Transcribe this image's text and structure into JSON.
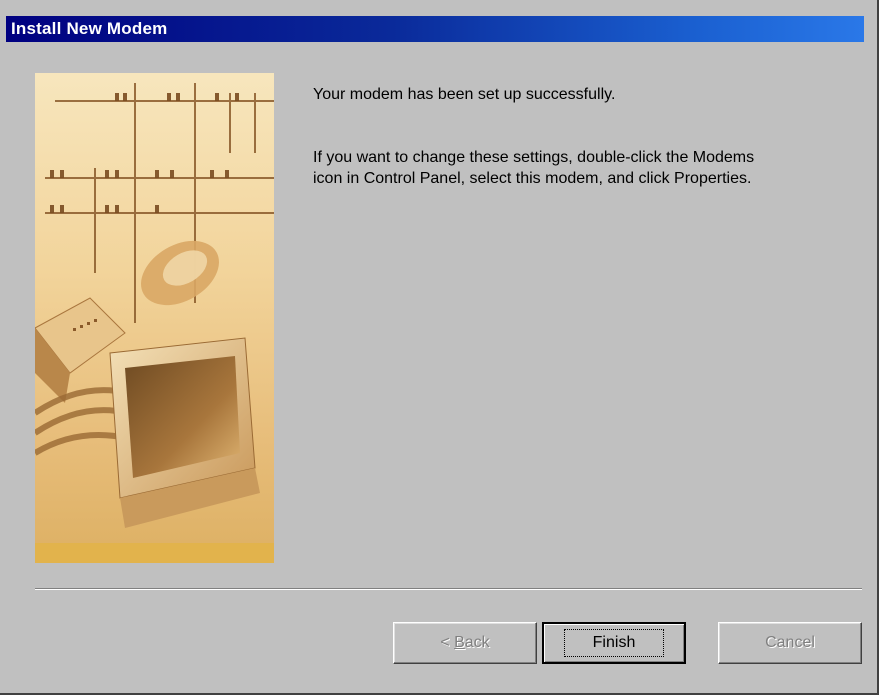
{
  "window": {
    "title": "Install New Modem"
  },
  "message": {
    "line1": "Your modem has been set up successfully.",
    "line2": "If you want to change these settings, double-click the Modems icon in Control Panel, select this modem, and click Properties."
  },
  "buttons": {
    "back_prefix": "< ",
    "back_accel": "B",
    "back_rest": "ack",
    "finish": "Finish",
    "cancel": "Cancel"
  },
  "colors": {
    "titlebar_start": "#000080",
    "titlebar_end": "#2a78e8",
    "dialog_face": "#c0c0c0"
  }
}
